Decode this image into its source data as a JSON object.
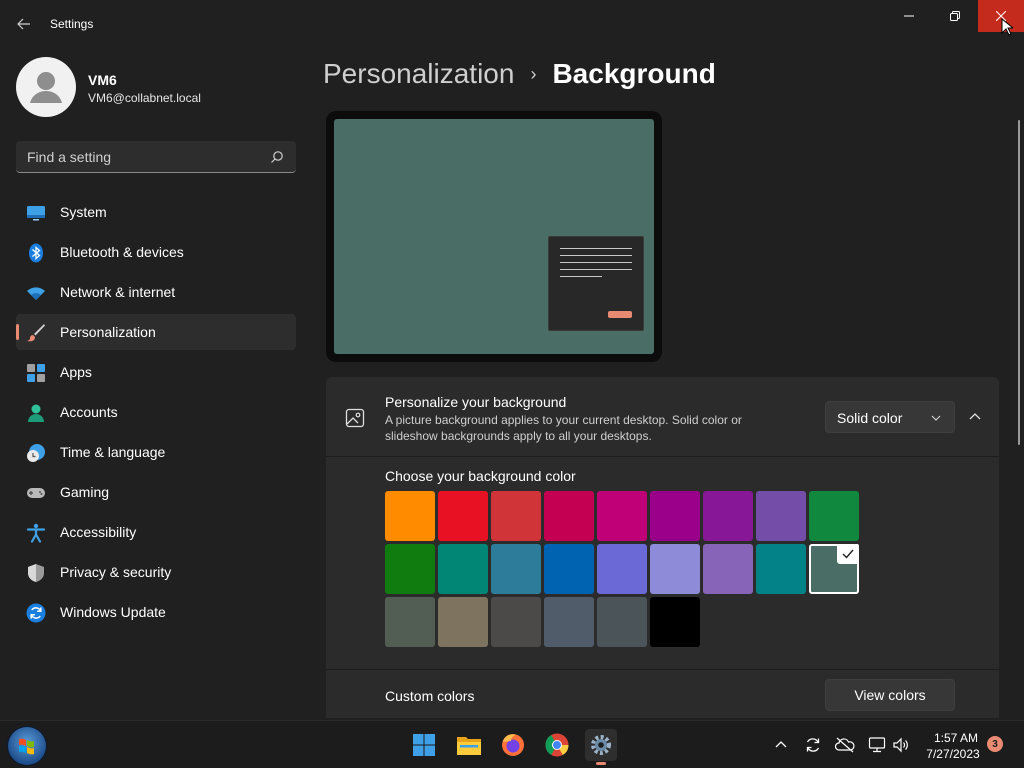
{
  "window": {
    "title": "Settings",
    "back_icon": "arrow-left-icon"
  },
  "profile": {
    "name": "VM6",
    "email": "VM6@collabnet.local"
  },
  "search": {
    "placeholder": "Find a setting"
  },
  "sidebar": {
    "items": [
      {
        "label": "System",
        "icon": "monitor-icon"
      },
      {
        "label": "Bluetooth & devices",
        "icon": "bluetooth-icon"
      },
      {
        "label": "Network & internet",
        "icon": "wifi-icon"
      },
      {
        "label": "Personalization",
        "icon": "paintbrush-icon",
        "selected": true
      },
      {
        "label": "Apps",
        "icon": "apps-icon"
      },
      {
        "label": "Accounts",
        "icon": "person-icon"
      },
      {
        "label": "Time & language",
        "icon": "globe-clock-icon"
      },
      {
        "label": "Gaming",
        "icon": "gamepad-icon"
      },
      {
        "label": "Accessibility",
        "icon": "accessibility-icon"
      },
      {
        "label": "Privacy & security",
        "icon": "shield-icon"
      },
      {
        "label": "Windows Update",
        "icon": "update-icon"
      }
    ]
  },
  "breadcrumb": {
    "parent": "Personalization",
    "current": "Background"
  },
  "background_card": {
    "title": "Personalize your background",
    "description": "A picture background applies to your current desktop. Solid color or slideshow backgrounds apply to all your desktops.",
    "dropdown_value": "Solid color",
    "swatch_title": "Choose your background color",
    "selected_color": "#4a6e66",
    "colors": [
      [
        "#ff8c00",
        "#e81123",
        "#d13438",
        "#c30052",
        "#bf0077",
        "#9a0089",
        "#881798",
        "#744da9",
        "#10893e"
      ],
      [
        "#107c10",
        "#018574",
        "#2d7d9a",
        "#0063b1",
        "#6b69d6",
        "#8e8cd8",
        "#8764b8",
        "#038387",
        "#4a6e66"
      ],
      [
        "#525e54",
        "#7e735f",
        "#4c4a48",
        "#515c6b",
        "#4a5459",
        "#000000"
      ]
    ]
  },
  "custom_colors": {
    "label": "Custom colors",
    "button": "View colors"
  },
  "taskbar": {
    "time": "1:57 AM",
    "date": "7/27/2023",
    "notification_count": "3"
  }
}
